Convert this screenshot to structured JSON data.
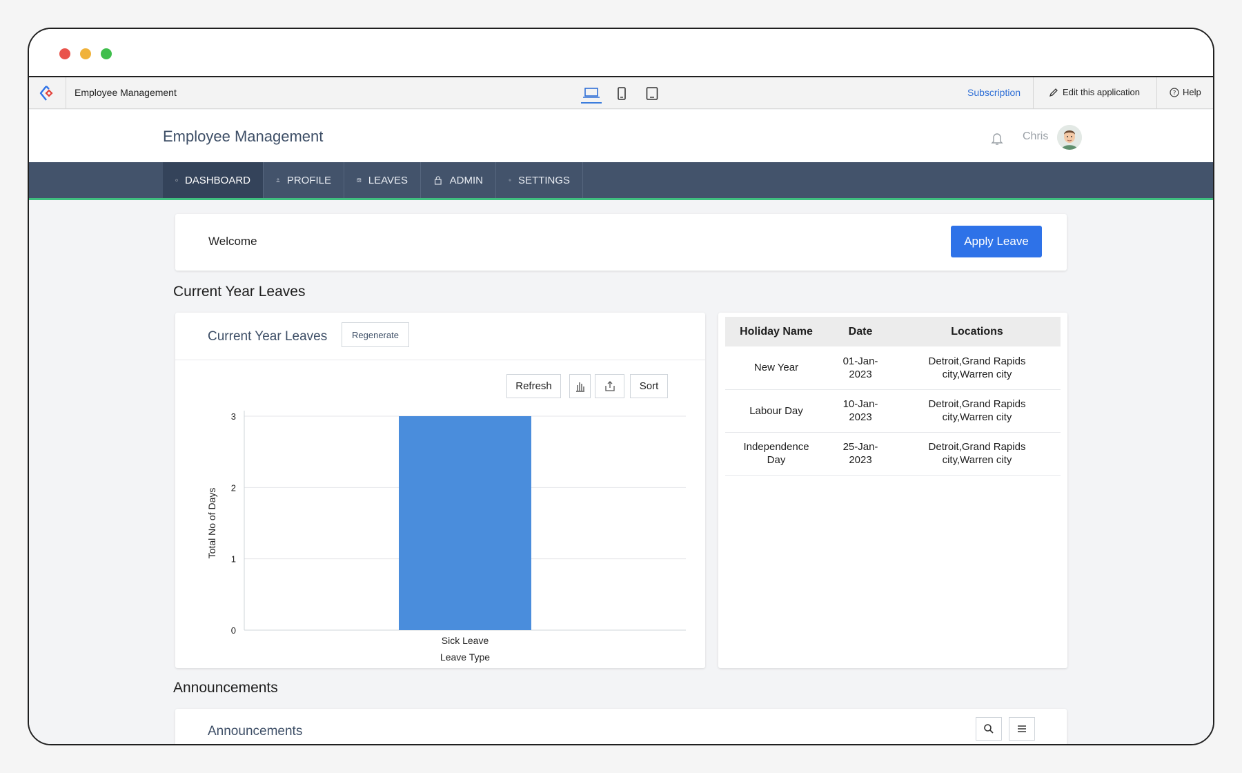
{
  "window": {
    "controls": [
      "close",
      "minimize",
      "maximize"
    ]
  },
  "appbar": {
    "app_name": "Employee Management",
    "subscription_label": "Subscription",
    "edit_label": "Edit this application",
    "help_label": "Help",
    "devices": [
      "laptop-icon",
      "tablet-icon",
      "phone-icon"
    ]
  },
  "header": {
    "title": "Employee Management",
    "user_name": "Chris"
  },
  "nav": {
    "items": [
      {
        "label": "DASHBOARD",
        "icon": "dashboard-icon",
        "active": true
      },
      {
        "label": "PROFILE",
        "icon": "user-icon"
      },
      {
        "label": "LEAVES",
        "icon": "calendar-icon"
      },
      {
        "label": "ADMIN",
        "icon": "lock-icon"
      },
      {
        "label": "SETTINGS",
        "icon": "gear-icon"
      }
    ]
  },
  "welcome": {
    "text": "Welcome",
    "apply_button": "Apply Leave"
  },
  "section_leaves": "Current Year Leaves",
  "leaves_card": {
    "title": "Current Year Leaves",
    "regenerate": "Regenerate",
    "refresh": "Refresh",
    "sort": "Sort"
  },
  "chart_data": {
    "type": "bar",
    "categories": [
      "Sick Leave"
    ],
    "values": [
      3
    ],
    "title": "",
    "xlabel": "Leave Type",
    "ylabel": "Total No of Days",
    "ylim": [
      0,
      3
    ],
    "yticks": [
      0,
      1,
      2,
      3
    ],
    "grid": true,
    "bar_color": "#4a8ddc"
  },
  "holidays": {
    "headers": [
      "Holiday Name",
      "Date",
      "Locations"
    ],
    "rows": [
      {
        "name": "New Year",
        "date_line1": "01-Jan-",
        "date_line2": "2023",
        "loc_line1": "Detroit,Grand Rapids",
        "loc_line2": "city,Warren city"
      },
      {
        "name": "Labour Day",
        "date_line1": "10-Jan-",
        "date_line2": "2023",
        "loc_line1": "Detroit,Grand Rapids",
        "loc_line2": "city,Warren city"
      },
      {
        "name_line1": "Independence",
        "name_line2": "Day",
        "date_line1": "25-Jan-",
        "date_line2": "2023",
        "loc_line1": "Detroit,Grand Rapids",
        "loc_line2": "city,Warren city"
      }
    ]
  },
  "section_announcements": "Announcements",
  "announcements_card": {
    "title": "Announcements"
  },
  "colors": {
    "nav_bg": "#43536b",
    "nav_active": "#34435a",
    "accent_line": "#3fbf7f",
    "primary_button": "#2e72e8",
    "title_text": "#3d4e66",
    "link": "#2f6fd6"
  }
}
